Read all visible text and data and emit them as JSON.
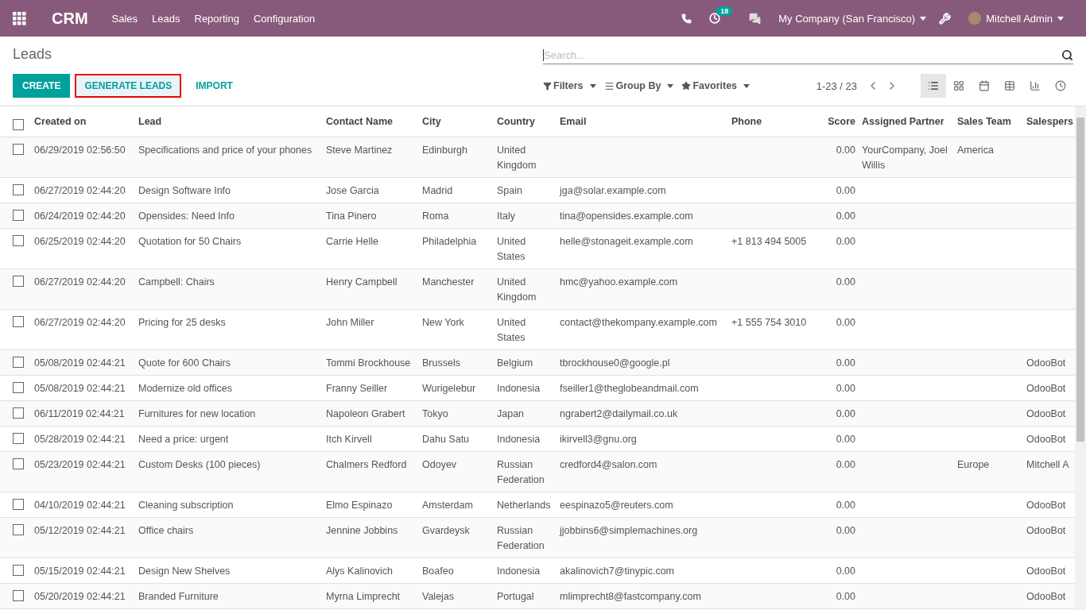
{
  "topbar": {
    "app": "CRM",
    "menu": [
      "Sales",
      "Leads",
      "Reporting",
      "Configuration"
    ],
    "activity_count": "18",
    "company": "My Company (San Francisco)",
    "user": "Mitchell Admin"
  },
  "control_panel": {
    "title": "Leads",
    "search": {
      "placeholder": "Search..."
    },
    "buttons": [
      {
        "label": "CREATE",
        "kind": "primary",
        "highlighted": false
      },
      {
        "label": "GENERATE LEADS",
        "kind": "link",
        "highlighted": true
      },
      {
        "label": "IMPORT",
        "kind": "link",
        "highlighted": false
      }
    ],
    "search_options": [
      {
        "label": "Filters",
        "kind": "filter"
      },
      {
        "label": "Group By",
        "kind": "group"
      },
      {
        "label": "Favorites",
        "kind": "star"
      }
    ],
    "pager": "1-23 / 23",
    "views": [
      {
        "kind": "list",
        "selected": true
      },
      {
        "kind": "kanban",
        "selected": false
      },
      {
        "kind": "calendar",
        "selected": false
      },
      {
        "kind": "pivot",
        "selected": false
      },
      {
        "kind": "graph",
        "selected": false
      },
      {
        "kind": "activity",
        "selected": false
      }
    ]
  },
  "table": {
    "select_all": {
      "checked": false
    },
    "columns": [
      {
        "label": "Created on",
        "kind": "text"
      },
      {
        "label": "Lead",
        "kind": "text"
      },
      {
        "label": "Contact Name",
        "kind": "text"
      },
      {
        "label": "City",
        "kind": "text"
      },
      {
        "label": "Country",
        "kind": "text"
      },
      {
        "label": "Email",
        "kind": "text"
      },
      {
        "label": "Phone",
        "kind": "text"
      },
      {
        "label": "Score",
        "kind": "number"
      },
      {
        "label": "Assigned Partner",
        "kind": "text"
      },
      {
        "label": "Sales Team",
        "kind": "text"
      },
      {
        "label": "Salespers",
        "kind": "text"
      }
    ],
    "rows": [
      {
        "checked": false,
        "cells": [
          "06/29/2019 02:56:50",
          "Specifications and price of your phones",
          "Steve Martinez",
          "Edinburgh",
          "United Kingdom",
          "",
          "",
          "0.00",
          "YourCompany, Joel Willis",
          "America",
          ""
        ]
      },
      {
        "checked": false,
        "cells": [
          "06/27/2019 02:44:20",
          "Design Software Info",
          "Jose Garcia",
          "Madrid",
          "Spain",
          "jga@solar.example.com",
          "",
          "0.00",
          "",
          "",
          ""
        ]
      },
      {
        "checked": false,
        "cells": [
          "06/24/2019 02:44:20",
          "Opensides: Need Info",
          "Tina Pinero",
          "Roma",
          "Italy",
          "tina@opensides.example.com",
          "",
          "0.00",
          "",
          "",
          ""
        ]
      },
      {
        "checked": false,
        "cells": [
          "06/25/2019 02:44:20",
          "Quotation for 50 Chairs",
          "Carrie Helle",
          "Philadelphia",
          "United States",
          "helle@stonageit.example.com",
          "+1 813 494 5005",
          "0.00",
          "",
          "",
          ""
        ]
      },
      {
        "checked": false,
        "cells": [
          "06/27/2019 02:44:20",
          "Campbell: Chairs",
          "Henry Campbell",
          "Manchester",
          "United Kingdom",
          "hmc@yahoo.example.com",
          "",
          "0.00",
          "",
          "",
          ""
        ]
      },
      {
        "checked": false,
        "cells": [
          "06/27/2019 02:44:20",
          "Pricing for 25 desks",
          "John Miller",
          "New York",
          "United States",
          "contact@thekompany.example.com",
          "+1 555 754 3010",
          "0.00",
          "",
          "",
          ""
        ]
      },
      {
        "checked": false,
        "cells": [
          "05/08/2019 02:44:21",
          "Quote for 600 Chairs",
          "Tommi Brockhouse",
          "Brussels",
          "Belgium",
          "tbrockhouse0@google.pl",
          "",
          "0.00",
          "",
          "",
          "OdooBot"
        ]
      },
      {
        "checked": false,
        "cells": [
          "05/08/2019 02:44:21",
          "Modernize old offices",
          "Franny Seiller",
          "Wurigelebur",
          "Indonesia",
          "fseiller1@theglobeandmail.com",
          "",
          "0.00",
          "",
          "",
          "OdooBot"
        ]
      },
      {
        "checked": false,
        "cells": [
          "06/11/2019 02:44:21",
          "Furnitures for new location",
          "Napoleon Grabert",
          "Tokyo",
          "Japan",
          "ngrabert2@dailymail.co.uk",
          "",
          "0.00",
          "",
          "",
          "OdooBot"
        ]
      },
      {
        "checked": false,
        "cells": [
          "05/28/2019 02:44:21",
          "Need a price: urgent",
          "Itch Kirvell",
          "Dahu Satu",
          "Indonesia",
          "ikirvell3@gnu.org",
          "",
          "0.00",
          "",
          "",
          "OdooBot"
        ]
      },
      {
        "checked": false,
        "cells": [
          "05/23/2019 02:44:21",
          "Custom Desks (100 pieces)",
          "Chalmers Redford",
          "Odoyev",
          "Russian Federation",
          "credford4@salon.com",
          "",
          "0.00",
          "",
          "Europe",
          "Mitchell A"
        ]
      },
      {
        "checked": false,
        "cells": [
          "04/10/2019 02:44:21",
          "Cleaning subscription",
          "Elmo Espinazo",
          "Amsterdam",
          "Netherlands",
          "eespinazo5@reuters.com",
          "",
          "0.00",
          "",
          "",
          "OdooBot"
        ]
      },
      {
        "checked": false,
        "cells": [
          "05/12/2019 02:44:21",
          "Office chairs",
          "Jennine Jobbins",
          "Gvardeysk",
          "Russian Federation",
          "jjobbins6@simplemachines.org",
          "",
          "0.00",
          "",
          "",
          "OdooBot"
        ]
      },
      {
        "checked": false,
        "cells": [
          "05/15/2019 02:44:21",
          "Design New Shelves",
          "Alys Kalinovich",
          "Boafeo",
          "Indonesia",
          "akalinovich7@tinypic.com",
          "",
          "0.00",
          "",
          "",
          "OdooBot"
        ]
      },
      {
        "checked": false,
        "cells": [
          "05/20/2019 02:44:21",
          "Branded Furniture",
          "Myrna Limprecht",
          "Valejas",
          "Portugal",
          "mlimprecht8@fastcompany.com",
          "",
          "0.00",
          "",
          "",
          "OdooBot"
        ]
      }
    ]
  }
}
